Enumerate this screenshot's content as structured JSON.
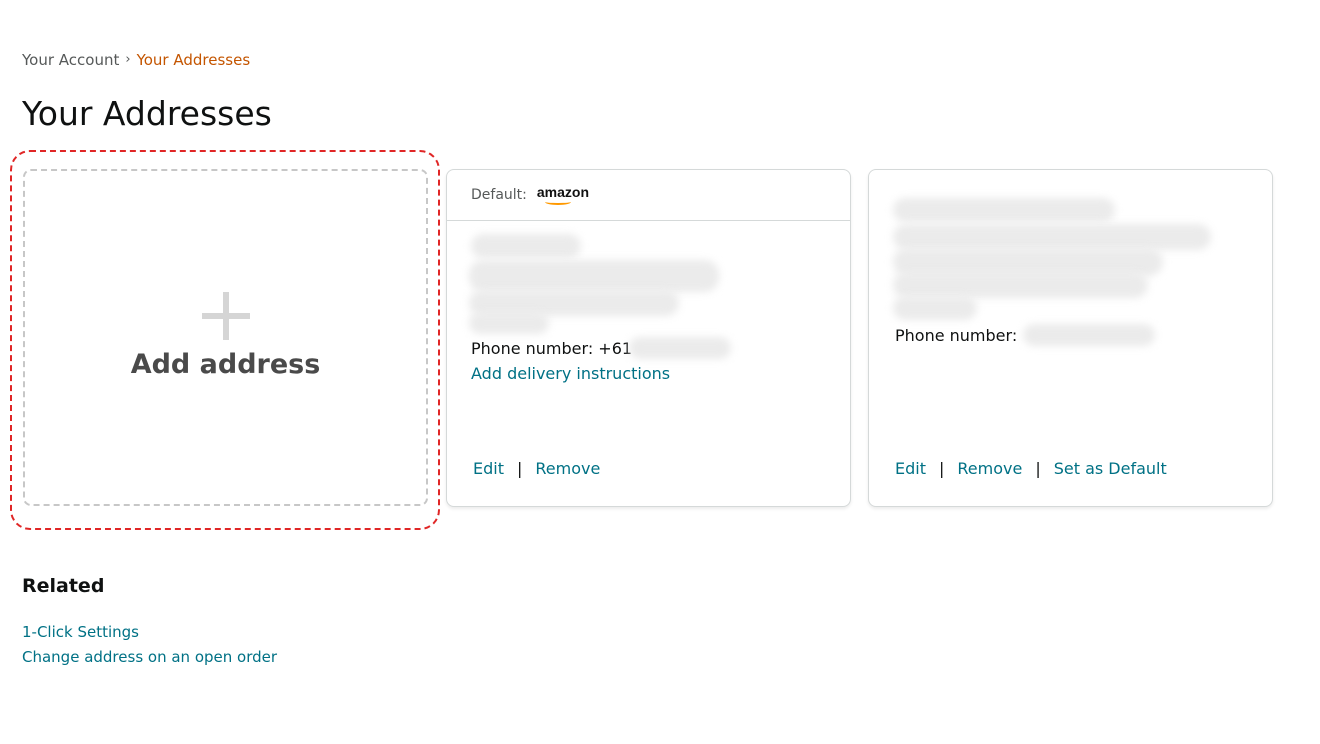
{
  "breadcrumb": {
    "parent": "Your Account",
    "separator": "›",
    "current": "Your Addresses"
  },
  "page_title": "Your Addresses",
  "add_card": {
    "icon": "plus-icon",
    "label": "Add address"
  },
  "addresses": [
    {
      "default_label": "Default:",
      "default_logo": "amazon",
      "phone_label": "Phone number: +61",
      "instructions_link": "Add delivery instructions",
      "actions": {
        "edit": "Edit",
        "remove": "Remove"
      }
    },
    {
      "phone_label": "Phone number:",
      "actions": {
        "edit": "Edit",
        "remove": "Remove",
        "set_default": "Set as Default"
      }
    }
  ],
  "actions_separator": "|",
  "related": {
    "title": "Related",
    "links": [
      "1-Click Settings",
      "Change address on an open order"
    ]
  },
  "colors": {
    "link": "#007185",
    "breadcrumb_current": "#c45500",
    "highlight": "#e02626",
    "logo_smile": "#ff9900"
  }
}
